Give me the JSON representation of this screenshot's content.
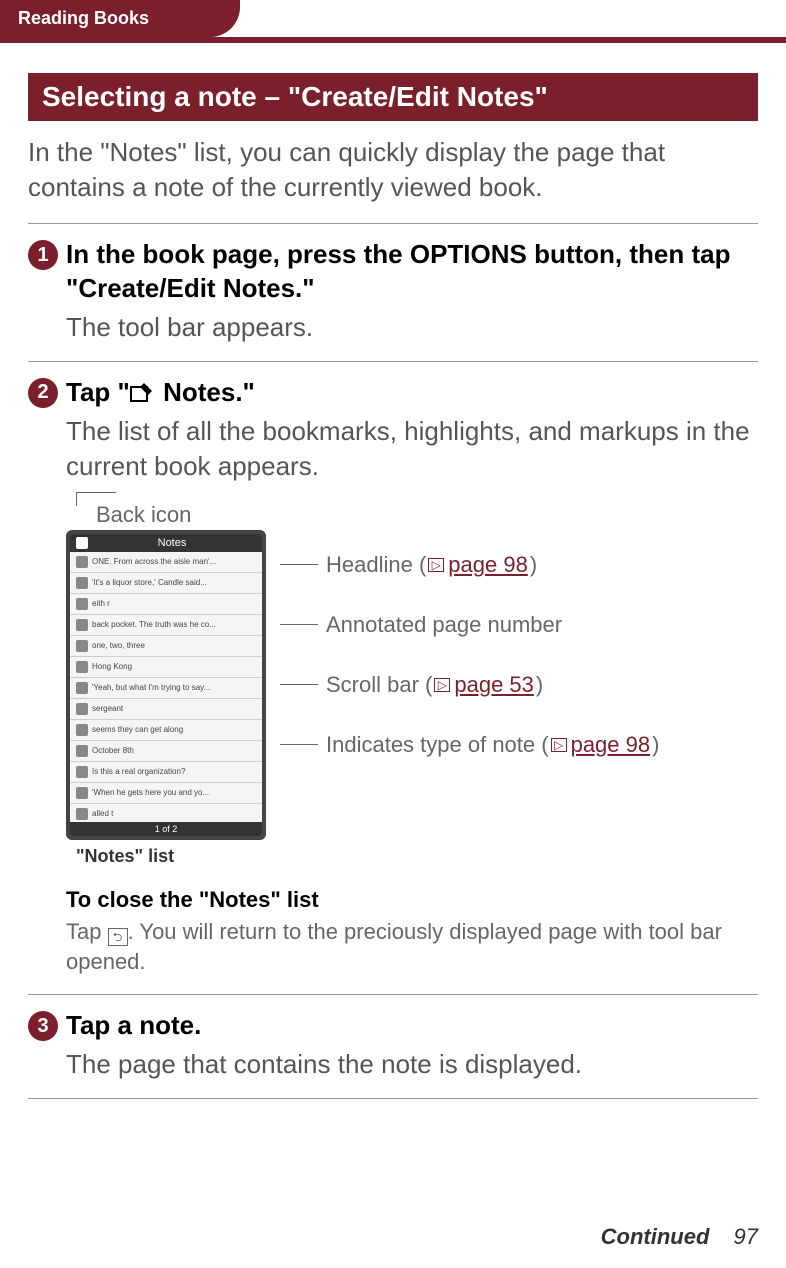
{
  "header": {
    "chapter": "Reading Books"
  },
  "section": {
    "title": "Selecting a note – \"Create/Edit Notes\""
  },
  "intro": "In the \"Notes\" list, you can quickly display the page that contains a note of the currently viewed book.",
  "steps": {
    "s1": {
      "num": "1",
      "title": "In the book page, press the OPTIONS button, then tap \"Create/Edit Notes.\"",
      "body": "The tool bar appears."
    },
    "s2": {
      "num": "2",
      "title_prefix": "Tap \"",
      "title_suffix": " Notes.\"",
      "body": "The list of all the bookmarks, highlights, and markups in the current book appears."
    },
    "s3": {
      "num": "3",
      "title": "Tap a note.",
      "body": "The page that contains the note is displayed."
    }
  },
  "diagram": {
    "back_label": "Back icon",
    "caption": "\"Notes\" list",
    "callouts": {
      "headline_pre": "Headline (",
      "headline_link": "page 98",
      "headline_post": ")",
      "annotated": "Annotated page number",
      "scroll_pre": "Scroll bar (",
      "scroll_link": "page 53",
      "scroll_post": ")",
      "type_pre": "Indicates type of note (",
      "type_link": "page 98",
      "type_post": ")"
    },
    "shot": {
      "header_title": "Notes",
      "item1": "ONE. From across the aisle man'...",
      "item2": "'It's a liquor store,' Candle said...",
      "item3": "eith r",
      "item4": "back pocket. The truth was he co...",
      "item5": "one, two, three",
      "item6": "Hong Kong",
      "item7": "'Yeah, but what I'm trying to say...",
      "item8": "sergeant",
      "item9": "seems they can get along",
      "item10": "October 8th",
      "item11": "Is this a real organization?",
      "item12": "'When he gets here you and yo...",
      "item13": "alled t",
      "footer": "1 of 2"
    }
  },
  "close": {
    "title": "To close the \"Notes\" list",
    "body_pre": "Tap ",
    "body_post": ". You will return to the preciously displayed page with tool bar opened."
  },
  "footer": {
    "continued": "Continued",
    "page": "97"
  }
}
